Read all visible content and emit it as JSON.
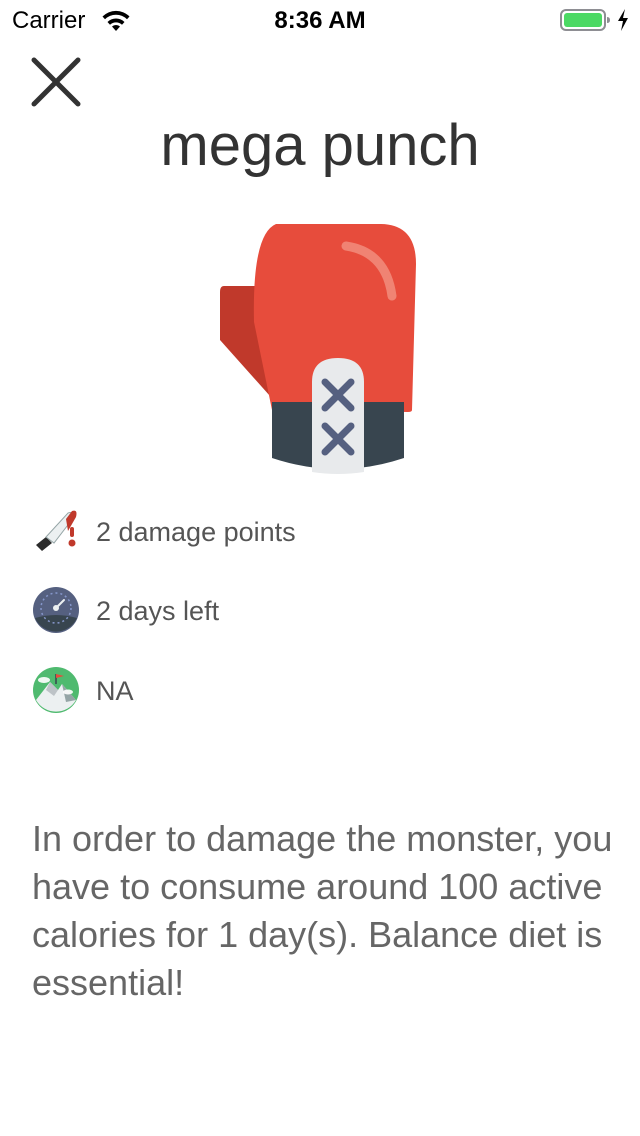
{
  "status_bar": {
    "carrier": "Carrier",
    "time": "8:36 AM",
    "battery_color": "#4cd964"
  },
  "header": {
    "close_icon": "close-icon",
    "title": "mega punch"
  },
  "item_image": {
    "icon": "boxing-glove-icon"
  },
  "stats": [
    {
      "icon": "damage-knife-icon",
      "label": "2 damage points"
    },
    {
      "icon": "gauge-timer-icon",
      "label": "2 days left"
    },
    {
      "icon": "mountain-flag-icon",
      "label": "NA"
    }
  ],
  "description": "In order to damage the monster, you have to consume around 100 active calories for 1 day(s). Balance diet is essential!",
  "colors": {
    "glove_red": "#e74c3c",
    "glove_dark_red": "#c0392b",
    "cuff_dark": "#38454f",
    "lace_blue": "#556080",
    "blood_red": "#c0392b"
  }
}
